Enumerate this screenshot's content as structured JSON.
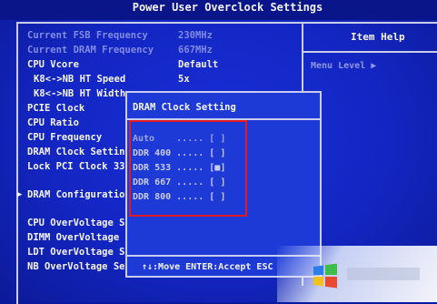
{
  "title": "Power User Overclock Settings",
  "menu": {
    "fsb_freq_label": "Current FSB Frequency",
    "fsb_freq_value": "230MHz",
    "dram_freq_label": "Current DRAM Frequency",
    "dram_freq_value": "667MHz",
    "cpu_vcore_label": "CPU Vcore",
    "cpu_vcore_value": "Default",
    "k8mb_speed_label": "K8<->NB HT Speed",
    "k8mb_speed_value": "5x",
    "k8mb_width_label": "K8<->NB HT Width",
    "pcie_clock_label": "PCIE Clock",
    "cpu_ratio_label": "CPU Ratio",
    "cpu_frequency_label": "CPU Frequency",
    "dram_clock_label": "DRAM Clock Settin",
    "lock_pci_label": "Lock PCI Clock 33",
    "dram_config_label": "DRAM Configuratio",
    "cpu_overvoltage_label": "CPU OverVoltage S",
    "dimm_overvoltage_label": "DIMM OverVoltage",
    "ldt_overvoltage_label": "LDT OverVoltage S",
    "nb_overvoltage_label": "NB OverVoltage Se"
  },
  "help": {
    "title": "Item Help",
    "menu_level": "Menu Level  ▶"
  },
  "popup": {
    "title": "DRAM Clock Setting",
    "options": [
      "Auto    ..... [ ]",
      "DDR 400 ..... [ ]",
      "DDR 533 ..... [■]",
      "DDR 667 ..... [ ]",
      "DDR 800 ..... [ ]"
    ],
    "footer": "↑↓:Move ENTER:Accept ESC"
  },
  "colors": {
    "background": "#1326c2",
    "popup": "#1d3ad6",
    "highlight_box": "#e01b24"
  }
}
